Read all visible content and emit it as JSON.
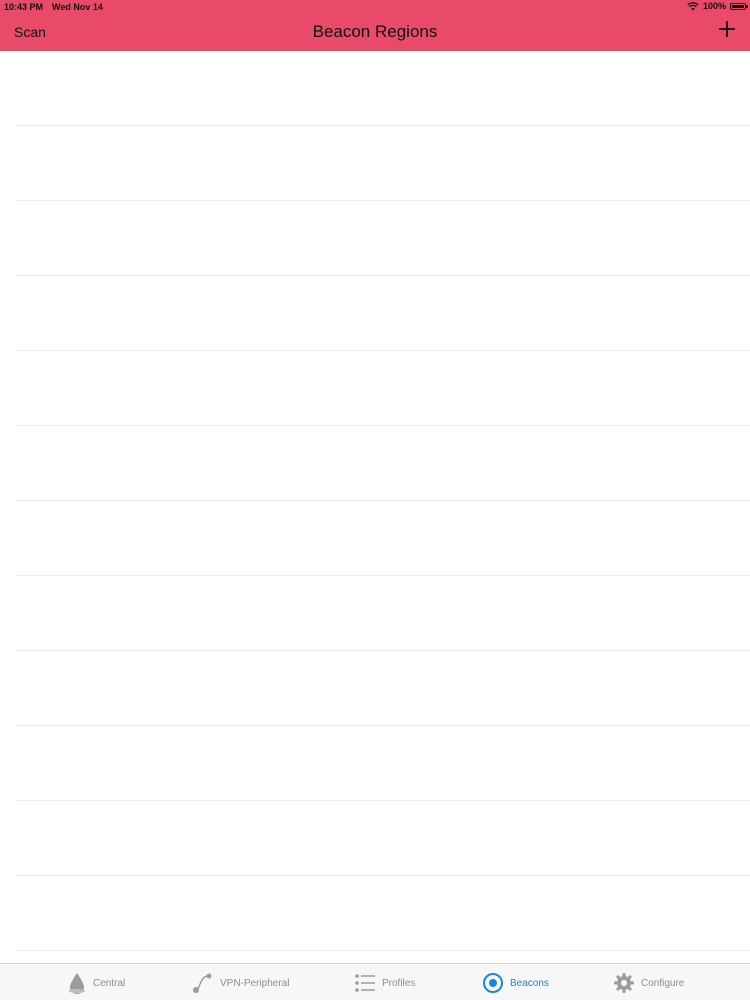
{
  "status_bar": {
    "time": "10:43 PM",
    "date": "Wed Nov 14",
    "battery": "100%"
  },
  "nav": {
    "left_label": "Scan",
    "title": "Beacon Regions",
    "right_icon": "plus-icon"
  },
  "colors": {
    "header": "#e84a68",
    "active_tab": "#1a86d6",
    "inactive_tab": "#8e8e93"
  },
  "tabs": [
    {
      "label": "Central",
      "icon": "drop-icon",
      "active": false
    },
    {
      "label": "VPN-Peripheral",
      "icon": "peripheral-icon",
      "active": false
    },
    {
      "label": "Profiles",
      "icon": "list-icon",
      "active": false
    },
    {
      "label": "Beacons",
      "icon": "beacon-icon",
      "active": true
    },
    {
      "label": "Configure",
      "icon": "gear-icon",
      "active": false
    }
  ]
}
